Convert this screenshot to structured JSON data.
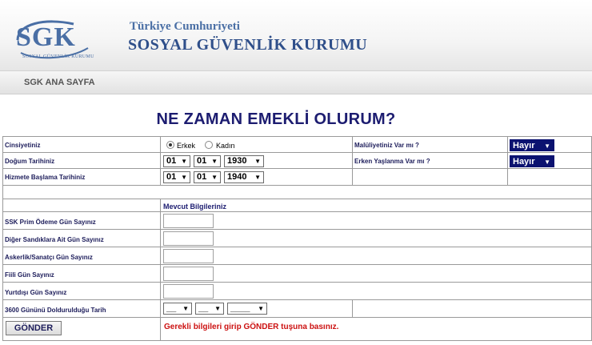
{
  "header": {
    "logo_text": "SGK",
    "logo_sub": "SOSYAL GÜVENLİK KURUMU",
    "title_line1": "Türkiye Cumhuriyeti",
    "title_line2": "SOSYAL GÜVENLİK KURUMU"
  },
  "nav": {
    "home_link": "SGK ANA SAYFA"
  },
  "page_title": "NE ZAMAN EMEKLİ OLURUM?",
  "form": {
    "gender_label": "Cinsiyetiniz",
    "gender_options": [
      "Erkek",
      "Kadın"
    ],
    "gender_selected": "Erkek",
    "disability_label": "Malüliyetiniz Var mı ?",
    "disability_value": "Hayır",
    "birth_label": "Doğum Tarihiniz",
    "birth_day": "01",
    "birth_month": "01",
    "birth_year": "1930",
    "early_aging_label": "Erken Yaşlanma Var mı ?",
    "early_aging_value": "Hayır",
    "start_label": "Hizmete Başlama Tarihiniz",
    "start_day": "01",
    "start_month": "01",
    "start_year": "1940",
    "section_title": "Mevcut  Bilgileriniz",
    "fields": [
      "SSK Prim Ödeme Gün Sayınız",
      "Diğer Sandıklara Ait Gün Sayınız",
      "Askerlik/Sanatçı Gün Sayınız",
      "Fiili Gün Sayınız",
      "Yurtdışı Gün Sayınız"
    ],
    "completion_label": "3600 Gününü Doldurulduğu Tarih",
    "completion_day": "__",
    "completion_month": "__",
    "completion_year": "____",
    "submit_label": "GÖNDER",
    "message": "Gerekli bilgileri girip GÖNDER tuşuna basınız."
  },
  "colors": {
    "title": "#1c1c70",
    "dark_select": "#0b1270",
    "message": "#cc1111",
    "logo": "#4a6fa5"
  }
}
